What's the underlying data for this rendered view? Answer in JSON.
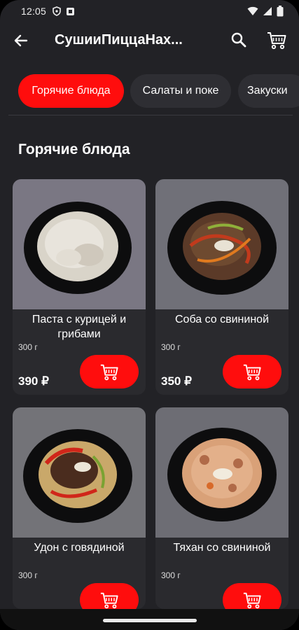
{
  "status": {
    "time": "12:05"
  },
  "app_bar": {
    "title": "СушииПиццаНах..."
  },
  "chips": [
    {
      "label": "Горячие блюда",
      "active": true
    },
    {
      "label": "Салаты и поке",
      "active": false
    },
    {
      "label": "Закуски",
      "active": false
    }
  ],
  "section": {
    "title": "Горячие блюда"
  },
  "products": [
    {
      "name": "Паста с курицей и грибами",
      "weight": "300 г",
      "price": "390 ₽"
    },
    {
      "name": "Соба со свининой",
      "weight": "300 г",
      "price": "350 ₽"
    },
    {
      "name": "Удон с говядиной",
      "weight": "300 г",
      "price": ""
    },
    {
      "name": "Тяхан со свининой",
      "weight": "300 г",
      "price": ""
    }
  ],
  "colors": {
    "accent": "#ff0d0d",
    "background": "#222226",
    "card": "#2a2a2e"
  },
  "icons": [
    "back-arrow-icon",
    "search-icon",
    "cart-icon",
    "add-to-cart-icon"
  ]
}
